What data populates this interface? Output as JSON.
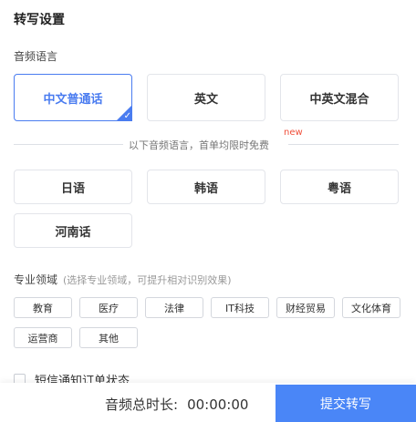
{
  "title": "转写设置",
  "language_section": {
    "label": "音频语言",
    "primary_options": [
      "中文普通话",
      "英文",
      "中英文混合"
    ],
    "selected": "中文普通话",
    "divider_text": "以下音频语言，首单均限时免费",
    "new_badge": "new",
    "extra_options": [
      "日语",
      "韩语",
      "粤语",
      "河南话"
    ]
  },
  "domain_section": {
    "label": "专业领域",
    "hint": "(选择专业领域，可提升相对识别效果)",
    "tags": [
      "教育",
      "医疗",
      "法律",
      "IT科技",
      "财经贸易",
      "文化体育",
      "运营商",
      "其他"
    ]
  },
  "sms_notify": {
    "label": "短信通知订单状态",
    "checked": false
  },
  "footer": {
    "duration_label": "音频总时长:",
    "duration_value": "00:00:00",
    "submit_label": "提交转写"
  },
  "colors": {
    "accent": "#4a7cf0",
    "submit_bg": "#4a86f7",
    "new_badge": "#f04f3a"
  },
  "icons": {
    "selected_corner": "check-icon"
  }
}
